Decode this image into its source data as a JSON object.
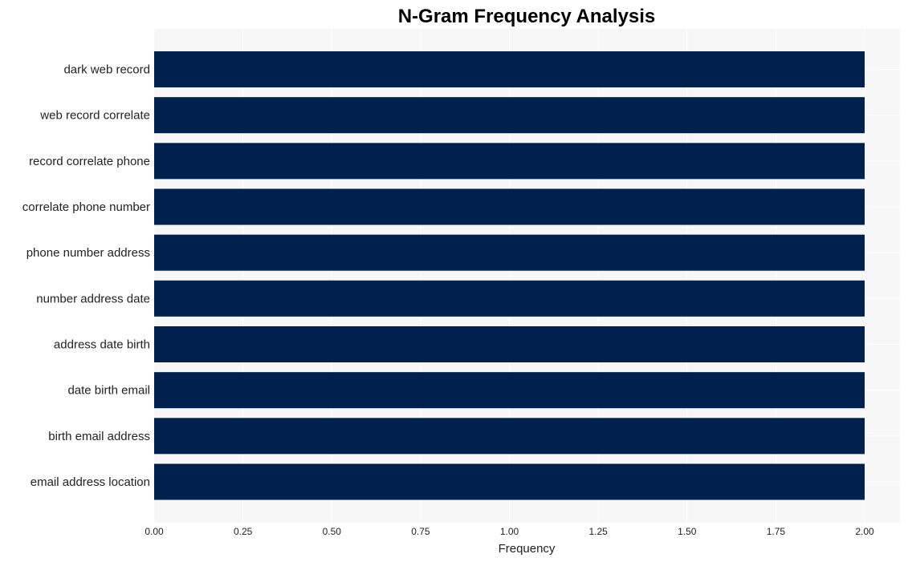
{
  "chart_data": {
    "type": "bar",
    "orientation": "horizontal",
    "title": "N-Gram Frequency Analysis",
    "xlabel": "Frequency",
    "ylabel": "",
    "categories": [
      "dark web record",
      "web record correlate",
      "record correlate phone",
      "correlate phone number",
      "phone number address",
      "number address date",
      "address date birth",
      "date birth email",
      "birth email address",
      "email address location"
    ],
    "values": [
      2,
      2,
      2,
      2,
      2,
      2,
      2,
      2,
      2,
      2
    ],
    "xlim": [
      0,
      2.1
    ],
    "xticks": [
      0,
      0.25,
      0.5,
      0.75,
      1.0,
      1.25,
      1.5,
      1.75,
      2.0
    ],
    "xtick_labels": [
      "0.00",
      "0.25",
      "0.50",
      "0.75",
      "1.00",
      "1.25",
      "1.50",
      "1.75",
      "2.00"
    ],
    "grid": true,
    "legend": "none",
    "colors": {
      "bar": "#00214d",
      "plot_background": "#f7f7f7",
      "grid": "#ffffff"
    }
  }
}
